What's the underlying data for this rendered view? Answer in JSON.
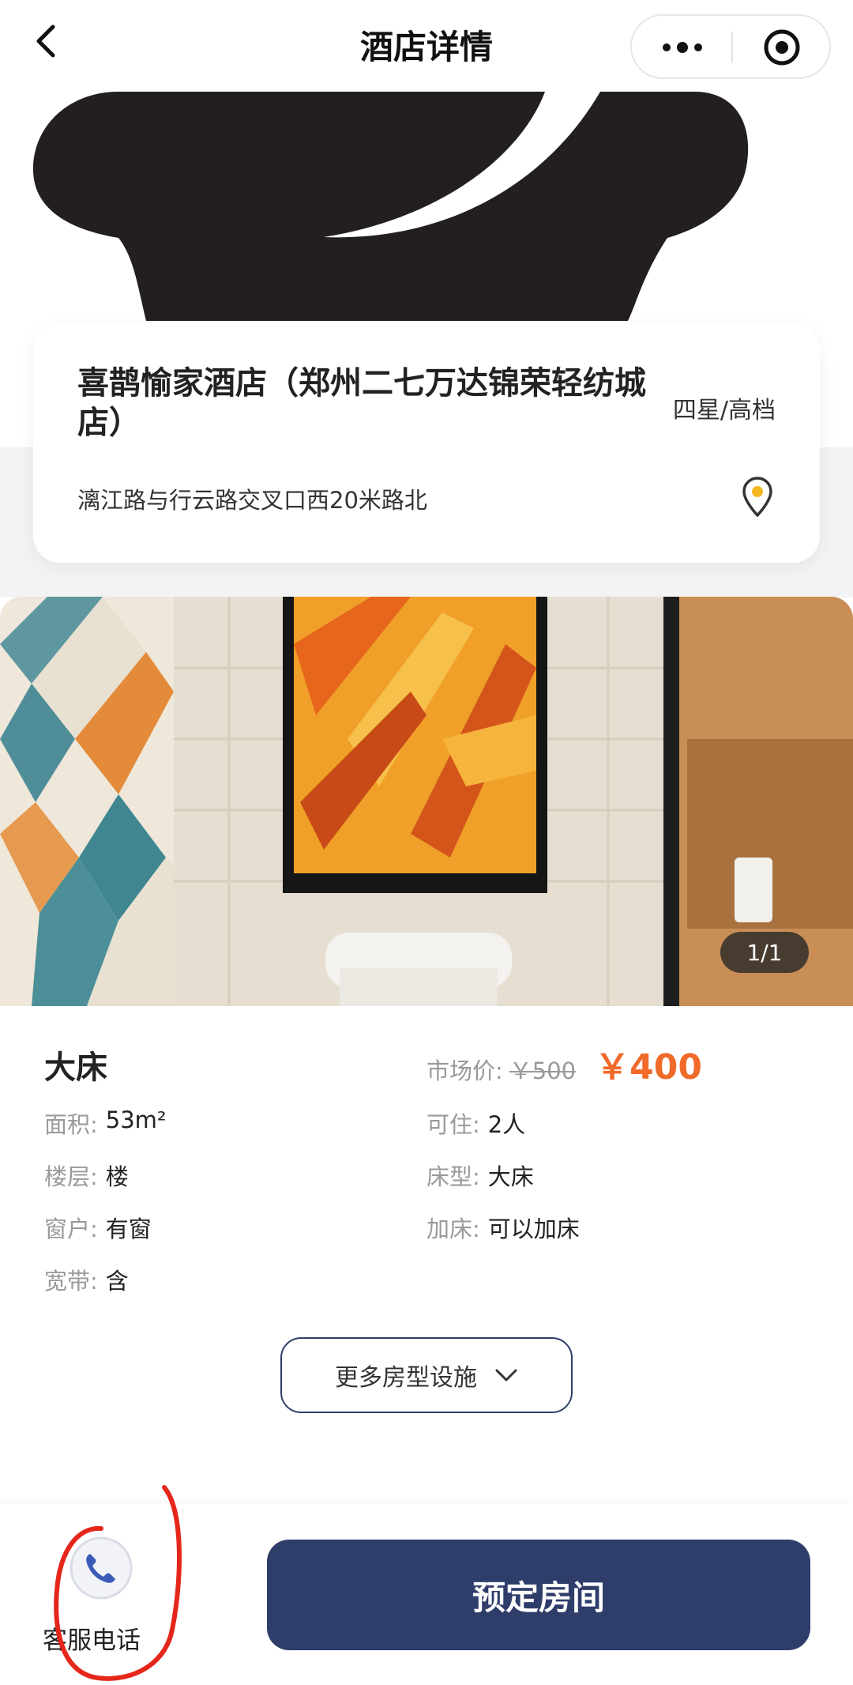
{
  "nav": {
    "title": "酒店详情"
  },
  "hotel": {
    "name": "喜鹊愉家酒店（郑州二七万达锦荣轻纺城店）",
    "grade": "四星/高档",
    "address": "漓江路与行云路交叉口西20米路北"
  },
  "photo": {
    "counter": "1/1"
  },
  "room": {
    "name": "大床",
    "price_label": "市场价:",
    "price_old": "￥500",
    "price_new": "￥400",
    "attributes": [
      {
        "key": "面积:",
        "value": "53m²"
      },
      {
        "key": "可住:",
        "value": "2人"
      },
      {
        "key": "楼层:",
        "value": "楼"
      },
      {
        "key": "床型:",
        "value": "大床"
      },
      {
        "key": "窗户:",
        "value": "有窗"
      },
      {
        "key": "加床:",
        "value": "可以加床"
      },
      {
        "key": "宽带:",
        "value": "含"
      }
    ]
  },
  "more_button": {
    "label": "更多房型设施"
  },
  "bottom": {
    "service_label": "客服电话",
    "book_label": "预定房间"
  },
  "colors": {
    "primary": "#2f3d6b",
    "price": "#f06a2a",
    "annotation": "#e5261b"
  }
}
